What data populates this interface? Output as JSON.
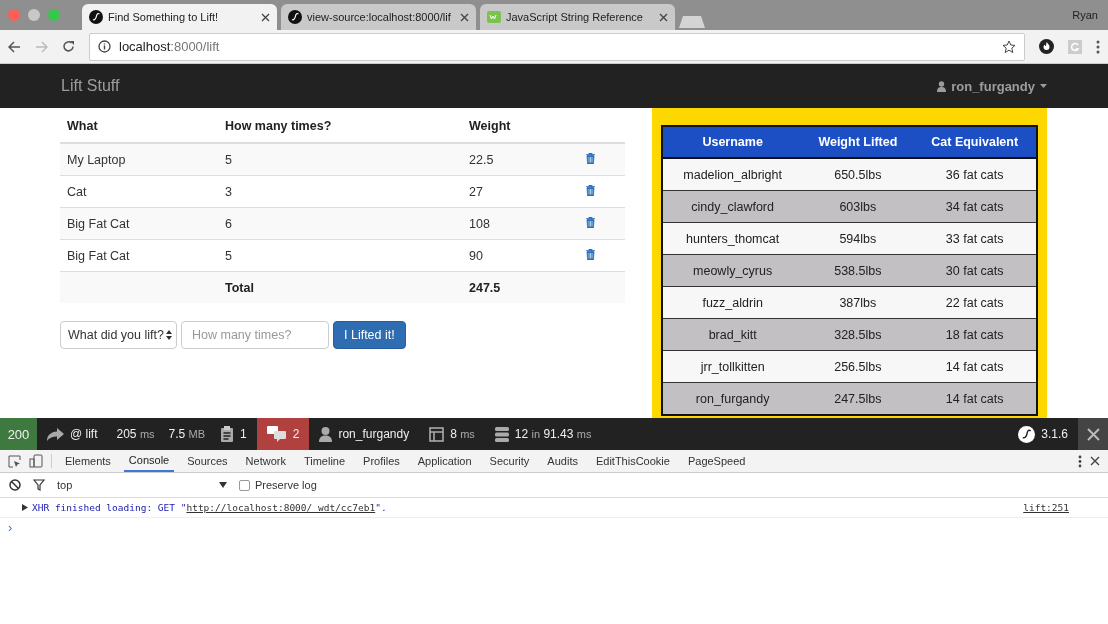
{
  "browser": {
    "tabs": [
      {
        "title": "Find Something to Lift!",
        "kind": "round",
        "selected": true
      },
      {
        "title": "view-source:localhost:8000/lif",
        "kind": "round",
        "selected": false
      },
      {
        "title": "JavaScript String Reference",
        "kind": "square",
        "selected": false
      }
    ],
    "profile": "Ryan",
    "url_host": "localhost",
    "url_rest": ":8000/lift"
  },
  "navbar": {
    "brand": "Lift Stuff",
    "user": "ron_furgandy"
  },
  "lifts": {
    "columns": [
      "What",
      "How many times?",
      "Weight"
    ],
    "rows": [
      {
        "what": "My Laptop",
        "times": "5",
        "weight": "22.5"
      },
      {
        "what": "Cat",
        "times": "3",
        "weight": "27"
      },
      {
        "what": "Big Fat Cat",
        "times": "6",
        "weight": "108"
      },
      {
        "what": "Big Fat Cat",
        "times": "5",
        "weight": "90"
      }
    ],
    "total_label": "Total",
    "total": "247.5"
  },
  "form": {
    "select": "What did you lift?",
    "placeholder": "How many times?",
    "button": "I Lifted it!"
  },
  "leaderboard": {
    "columns": [
      "Username",
      "Weight Lifted",
      "Cat Equivalent"
    ],
    "rows": [
      {
        "username": "madelion_albright",
        "weight": "650.5lbs",
        "cats": "36 fat cats"
      },
      {
        "username": "cindy_clawford",
        "weight": "603lbs",
        "cats": "34 fat cats"
      },
      {
        "username": "hunters_thomcat",
        "weight": "594lbs",
        "cats": "33 fat cats"
      },
      {
        "username": "meowly_cyrus",
        "weight": "538.5lbs",
        "cats": "30 fat cats"
      },
      {
        "username": "fuzz_aldrin",
        "weight": "387lbs",
        "cats": "22 fat cats"
      },
      {
        "username": "brad_kitt",
        "weight": "328.5lbs",
        "cats": "18 fat cats"
      },
      {
        "username": "jrr_tollkitten",
        "weight": "256.5lbs",
        "cats": "14 fat cats"
      },
      {
        "username": "ron_furgandy",
        "weight": "247.5lbs",
        "cats": "14 fat cats"
      }
    ]
  },
  "profiler": {
    "status": "200",
    "route": "@ lift",
    "time": "205",
    "time_unit": "ms",
    "memory": "7.5",
    "memory_unit": "MB",
    "logs": "1",
    "translations": "2",
    "user": "ron_furgandy",
    "twig": "8",
    "twig_unit": "ms",
    "db": "12",
    "db_in": "in",
    "db_time": "91.43",
    "db_unit": "ms",
    "version": "3.1.6"
  },
  "devtools": {
    "tabs": [
      {
        "label": "Elements",
        "selected": false
      },
      {
        "label": "Console",
        "selected": true
      },
      {
        "label": "Sources",
        "selected": false
      },
      {
        "label": "Network",
        "selected": false
      },
      {
        "label": "Timeline",
        "selected": false
      },
      {
        "label": "Profiles",
        "selected": false
      },
      {
        "label": "Application",
        "selected": false
      },
      {
        "label": "Security",
        "selected": false
      },
      {
        "label": "Audits",
        "selected": false
      },
      {
        "label": "EditThisCookie",
        "selected": false
      },
      {
        "label": "PageSpeed",
        "selected": false
      }
    ],
    "context": "top",
    "preserve_log": {
      "label": "Preserve log",
      "checked": false
    },
    "message": {
      "text": "XHR finished loading: GET \"",
      "link": "http://localhost:8000/_wdt/cc7eb1",
      "end": "\".",
      "source": "lift:251"
    },
    "prompt": "›"
  }
}
